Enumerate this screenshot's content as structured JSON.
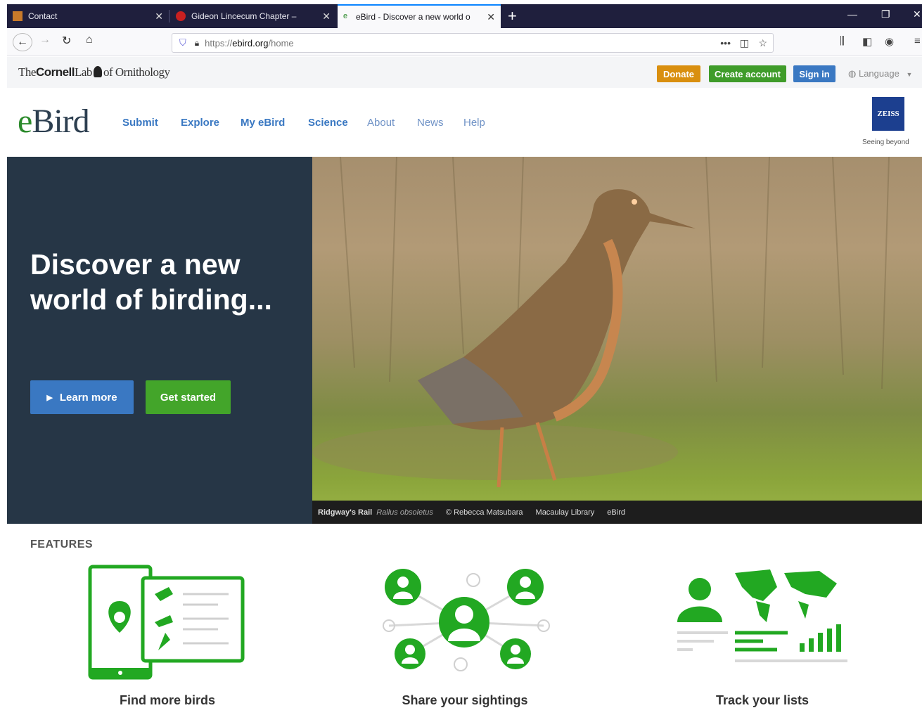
{
  "browser": {
    "tabs": [
      {
        "title": "Contact",
        "active": false
      },
      {
        "title": "Gideon Lincecum Chapter – ",
        "active": false
      },
      {
        "title": "eBird - Discover a new world o",
        "active": true
      }
    ],
    "new_tab_symbol": "+",
    "url_prefix": "https://",
    "url_host": "ebird.org",
    "url_path": "/home",
    "page_actions": "•••"
  },
  "cornell": {
    "logo_the": "The",
    "logo_cornell": "Cornell",
    "logo_lab": "Lab",
    "logo_orn": "of Ornithology",
    "donate": "Donate",
    "create_account": "Create account",
    "sign_in": "Sign in",
    "language": "Language",
    "colors": {
      "donate": "#d98f0f",
      "create": "#3f9c2a",
      "signin": "#3a78c2"
    }
  },
  "nav": {
    "logo_e": "e",
    "logo_bird": "Bird",
    "links": [
      "Submit",
      "Explore",
      "My eBird",
      "Science",
      "About",
      "News",
      "Help"
    ],
    "sponsor": "ZEISS",
    "sponsor_tag": "Seeing beyond"
  },
  "hero": {
    "title": "Discover a new world of birding...",
    "learn_more": "Learn more",
    "get_started": "Get started",
    "caption_species": "Ridgway's Rail",
    "caption_sci": "Rallus obsoletus",
    "caption_credit": "© Rebecca Matsubara",
    "caption_library": "Macaulay Library",
    "caption_ebird": "eBird",
    "colors": {
      "panel": "#263646",
      "learn": "#3a78c2",
      "start": "#43a52a"
    }
  },
  "features": {
    "heading": "FEATURES",
    "items": [
      "Find more birds",
      "Share your sightings",
      "Track your lists"
    ],
    "accent": "#22a822"
  }
}
